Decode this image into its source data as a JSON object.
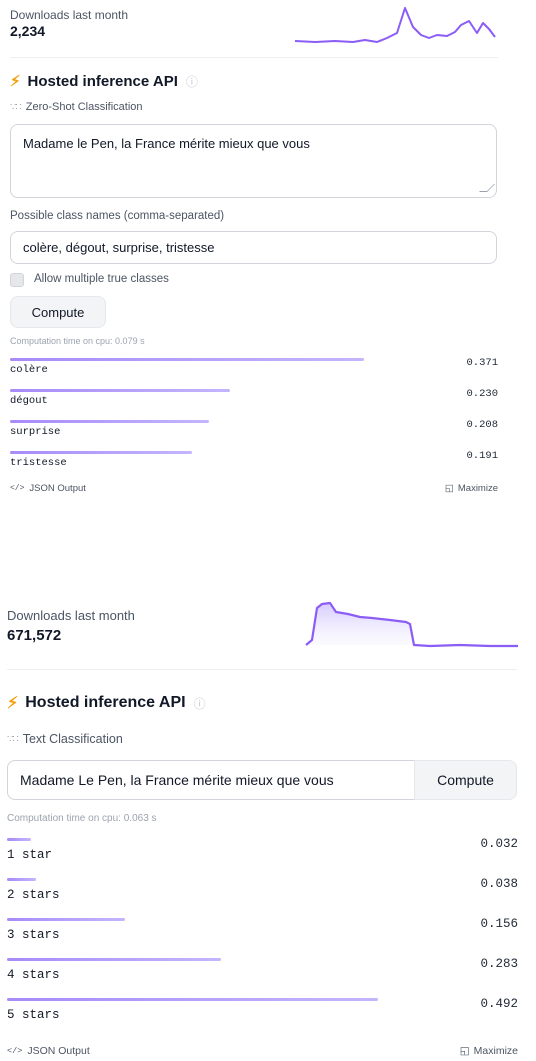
{
  "panel1": {
    "downloads_label": "Downloads last month",
    "downloads_count": "2,234",
    "api_title": "Hosted inference API",
    "task": "Zero-Shot Classification",
    "input_text": "Madame le Pen, la France mérite mieux que vous",
    "classes_label": "Possible class names (comma-separated)",
    "classes_value": "colère, dégout, surprise, tristesse",
    "multi_label": "Allow multiple true classes",
    "compute_label": "Compute",
    "computation_time": "Computation time on cpu: 0.079 s",
    "results": [
      {
        "label": "colère",
        "score": "0.371",
        "value": 0.371
      },
      {
        "label": "dégout",
        "score": "0.230",
        "value": 0.23
      },
      {
        "label": "surprise",
        "score": "0.208",
        "value": 0.208
      },
      {
        "label": "tristesse",
        "score": "0.191",
        "value": 0.191
      }
    ],
    "json_output": "JSON Output",
    "maximize": "Maximize"
  },
  "panel2": {
    "downloads_label": "Downloads last month",
    "downloads_count": "671,572",
    "api_title": "Hosted inference API",
    "task": "Text Classification",
    "input_text": "Madame Le Pen, la France mérite mieux que vous",
    "compute_label": "Compute",
    "computation_time": "Computation time on cpu: 0.063 s",
    "results": [
      {
        "label": "1 star",
        "score": "0.032",
        "value": 0.032
      },
      {
        "label": "2 stars",
        "score": "0.038",
        "value": 0.038
      },
      {
        "label": "3 stars",
        "score": "0.156",
        "value": 0.156
      },
      {
        "label": "4 stars",
        "score": "0.283",
        "value": 0.283
      },
      {
        "label": "5 stars",
        "score": "0.492",
        "value": 0.492
      }
    ],
    "json_output": "JSON Output",
    "maximize": "Maximize"
  },
  "colors": {
    "accent": "#8b5cf6",
    "bolt": "#f59e0b"
  },
  "icons": [
    "lightning-icon",
    "info-icon",
    "task-icon",
    "code-icon",
    "maximize-icon",
    "resize-handle-icon"
  ]
}
